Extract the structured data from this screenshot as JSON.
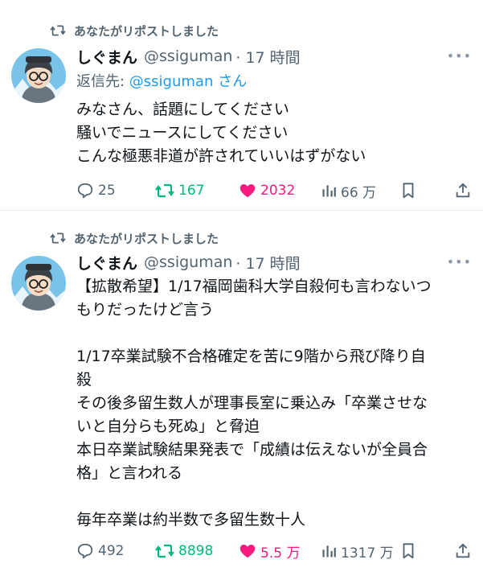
{
  "tweets": [
    {
      "repost_label": "あなたがリポストしました",
      "name": "しぐまん",
      "handle": "@ssiguman",
      "time": "· 17 時間",
      "reply_prefix": "返信先: ",
      "reply_mention": "@ssiguman",
      "reply_suffix": " さん",
      "text": "みなさん、話題にしてください\n騒いでニュースにしてください\nこんな極悪非道が許されていいはずがない",
      "replies": "25",
      "reposts": "167",
      "likes": "2032",
      "views": "66 万"
    },
    {
      "repost_label": "あなたがリポストしました",
      "name": "しぐまん",
      "handle": "@ssiguman",
      "time": "· 17 時間",
      "text": "【拡散希望】1/17福岡歯科大学自殺何も言わないつ\nもりだったけど言う\n\n1/17卒業試験不合格確定を苦に9階から飛び降り自\n殺\nその後多留生数人が理事長室に乗込み「卒業させな\nいと自分らも死ぬ」と脅迫\n本日卒業試験結果発表で「成績は伝えないが全員合\n格」と言われる\n\n毎年卒業は約半数で多留生数十人",
      "replies": "492",
      "reposts": "8898",
      "likes": "5.5 万",
      "views": "1317 万"
    }
  ],
  "colors": {
    "accent": "#1d9bf0",
    "repost": "#00ba7c",
    "like": "#f91880",
    "muted": "#536471"
  },
  "icons": [
    "repost-icon",
    "more-icon",
    "reply-icon",
    "heart-icon",
    "views-icon",
    "bookmark-icon",
    "share-icon"
  ]
}
